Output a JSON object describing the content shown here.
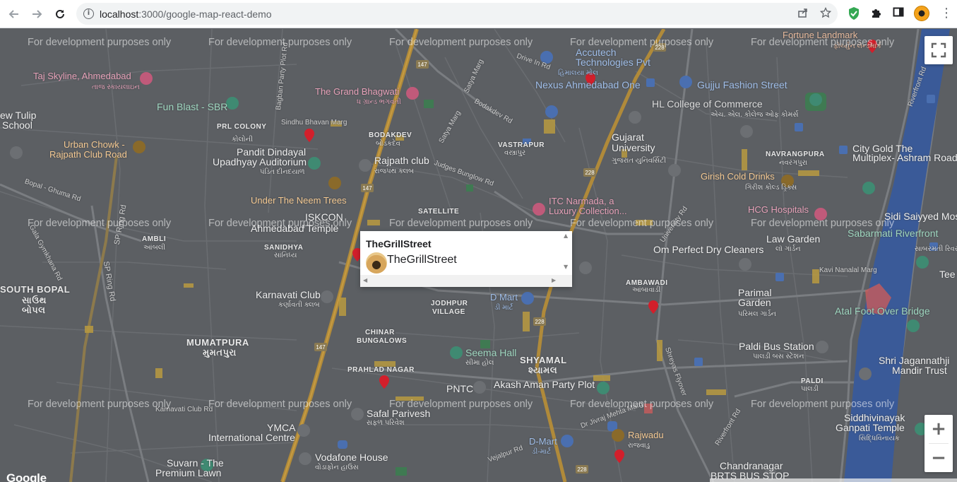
{
  "browser": {
    "url_host": "localhost",
    "url_path": ":3000/google-map-react-demo",
    "back_icon": "arrow-left",
    "forward_icon": "arrow-right",
    "reload_icon": "reload",
    "info_icon": "i",
    "share_icon": "share",
    "star_icon": "star",
    "menu_icon": "⋮"
  },
  "map": {
    "watermark": "For development purposes only",
    "google_logo": "Google",
    "zoom_in": "+",
    "zoom_out": "−",
    "labels": {
      "fortune": "Fortune Landmark",
      "fortune_local": "ફોર્ચ્યુન લેન્ડમાર્ક",
      "accutech": "Accutech",
      "accutech2": "Technologies Pvt",
      "accutech_local": "હિમાલયા મોલ",
      "taj": "Taj Skyline, Ahmedabad",
      "taj_local": "તાજ સ્કાયલાઇન",
      "grand": "The Grand Bhagwati",
      "grand_local": "ધ ગ્રાન્ડ ભગવતી",
      "nexus": "Nexus Ahmedabad One",
      "gujju": "Gujju Fashion Street",
      "funblast": "Fun Blast - SBR",
      "hl": "HL College of Commerce",
      "hl_local": "એચ. એલ. કોલેજ ઓફ કોમર્સ",
      "tulip": "ew Tulip",
      "tulip2": "School",
      "prl": "PRL COLONY",
      "prl_local": "કોલોની",
      "sindhu": "Sindhu Bhavan Marg",
      "bodakdev": "BODAKDEV",
      "bodakdev_local": "બોડકદેવ",
      "gujarat_uni": "Gujarat",
      "gujarat_uni2": "University",
      "gujarat_uni_local": "ગુજરાત યુનિવર્સિટી",
      "urban": "Urban Chowk -",
      "urban2": "Rajpath Club Road",
      "vastrapur": "VASTRAPUR",
      "vastrapur_local": "વસ્ત્રાપુર",
      "navrang": "NAVRANGPURA",
      "navrang_local": "નવરંગપુરા",
      "citygold": "City Gold The",
      "citygold2": "Multiplex- Ashram Road",
      "pandit": "Pandit Dindayal",
      "pandit2": "Upadhyay Auditorium",
      "pandit_local": "પંડિત દીનદયાળ",
      "rajpath": "Rajpath club",
      "rajpath_local": "રાજપથ ક્લબ",
      "girish": "Girish Cold Drinks",
      "girish_local": "ગિરીશ કોલ્ડ ડ્રિંક્સ",
      "neem": "Under The Neem Trees",
      "itc": "ITC Narmada, a",
      "itc2": "Luxury Collection...",
      "hcg": "HCG Hospitals",
      "sidi": "Sidi Saiyyed Mos",
      "sabarmati": "Sabarmati Riverfront",
      "sabarmati_local": "સાબરમતી રિવરફ્રન્ટ",
      "iskcon": "ISKCON",
      "satellite": "SATELLITE",
      "ambli": "AMBLI",
      "ambli_local": "આંબલી",
      "sanidhya": "SANIDHYA",
      "sanidhya_local": "સાંનિધ્ય",
      "ahmedabad_temple": "Ahmedabad Temple",
      "lawgarden": "Law Garden",
      "lawgarden_local": "લૉ ગાર્ડન",
      "omperfect": "Om Perfect Dry Cleaners",
      "ambawadi": "AMBAWADI",
      "ambawadi_local": "આંબાવાડી",
      "southbopal": "SOUTH BOPAL",
      "southbopal_local": "સાઉથ",
      "southbopal_local2": "બોપલ",
      "karnavati": "Karnavati Club",
      "karnavati_local": "કર્ણાવતી ક્લબ",
      "dmart1": "D Mart",
      "dmart1_local": "ડી માર્ટ",
      "jodhpur": "JODHPUR",
      "jodhpur2": "VILLAGE",
      "parimal": "Parimal",
      "parimal2": "Garden",
      "parimal_local": "પરિમલ ગાર્ડન",
      "atal": "Atal Foot Over Bridge",
      "teej": "Tee",
      "chinar": "CHINAR",
      "chinar2": "BUNGALOWS",
      "mumatpura": "MUMATPURA",
      "mumatpura_local": "મુમતપુરા",
      "seema": "Seema Hall",
      "seema_local": "સીમા હોલ",
      "shyamal": "SHYAMAL",
      "shyamal_local": "શ્યામલ",
      "paldibus": "Paldi Bus Station",
      "paldibus_local": "પાલડી બસ સ્ટેશન",
      "shri": "Shri Jagannathji",
      "shri2": "Mandir Trust",
      "prahlad": "PRAHLAD NAGAR",
      "pntc": "PNTC",
      "akash": "Akash Aman Party Plot",
      "paldi": "PALDI",
      "paldi_local": "પાલડી",
      "safal": "Safal Parivesh",
      "safal_local": "સફળ પરિવેશ",
      "ymca": "YMCA",
      "ymca2": "International Centre",
      "siddhi": "Siddhivinayak",
      "siddhi2": "Ganpati Temple",
      "siddhi_local": "સિદ્ધિવિનાયક",
      "rajwadu": "Rajwadu",
      "rajwadu_local": "રાજવાડુ",
      "dmart2": "D-Mart",
      "dmart2_local": "ડી-માર્ટ",
      "suvarn": "Suvarn - The",
      "suvarn2": "Premium Lawn",
      "vodafone": "Vodafone House",
      "vodafone_local": "વોડાફોન હાઉસ",
      "chandranagar": "Chandranagar",
      "brts": "BRTS BUS STOP",
      "karnavati_club_road": "Karnavati Club Rd",
      "bopal_ghuma": "Bopal - Ghuma Rd",
      "gala_gymkhana": "Gala Gymkhana Rd",
      "sp_ring": "SP Ring Rd",
      "judges": "Judges Bunglow Rd",
      "drive_in": "Drive In Rd",
      "bodakdev_rd": "Bodakdev Rd",
      "bagban": "Bagban Party Plot Rd",
      "satya": "Satya Marg",
      "university_rd": "University Rd",
      "kavi_nanalal": "Kavi Nanalal Marg",
      "shreyas": "Shreyas Flyover",
      "vejalpur": "Vejalpur Rd",
      "riverfront": "Riverfront Rd",
      "dr_jivraj": "Dr Jivraj Mehta Marg",
      "r147": "147",
      "r228": "228"
    }
  },
  "infowindow": {
    "title": "TheGrillStreet",
    "name": "TheGrillStreet"
  }
}
